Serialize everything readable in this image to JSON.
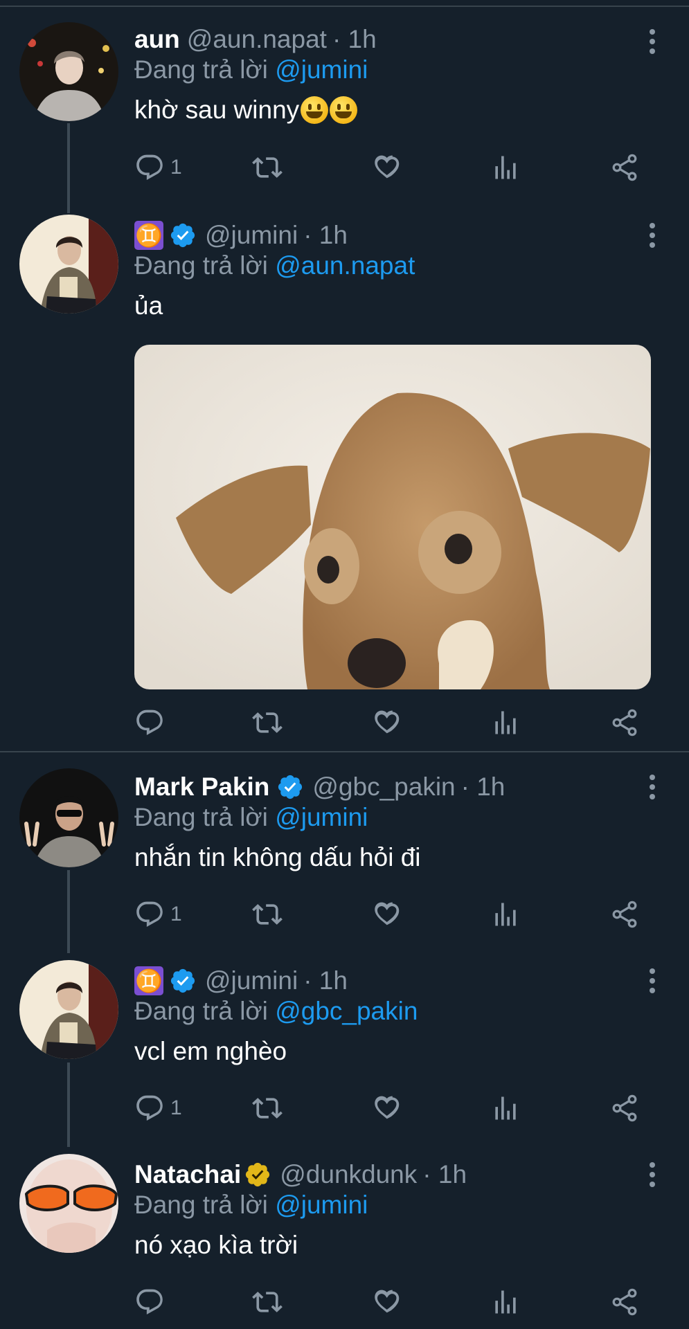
{
  "tweets": [
    {
      "name": "aun",
      "handle": "@aun.napat",
      "time": "· 1h",
      "reply_prefix": "Đang trả lời",
      "reply_to": "@jumini",
      "text": "khờ sau winny",
      "emojis": [
        "grinning-face",
        "grinning-face"
      ],
      "reply_count": "1",
      "verified": null
    },
    {
      "name": "♊",
      "handle": "@jumini",
      "time": "· 1h",
      "reply_prefix": "Đang trả lời",
      "reply_to": "@aun.napat",
      "text": "ủa",
      "reply_count": "",
      "verified": "blue",
      "media": "puppy-image"
    },
    {
      "name": "Mark Pakin",
      "handle": "@gbc_pakin",
      "time": "· 1h",
      "reply_prefix": "Đang trả lời",
      "reply_to": "@jumini",
      "text": "nhắn tin không dấu hỏi đi",
      "reply_count": "1",
      "verified": "blue"
    },
    {
      "name": "♊",
      "handle": "@jumini",
      "time": "· 1h",
      "reply_prefix": "Đang trả lời",
      "reply_to": "@gbc_pakin",
      "text": "vcl em nghèo",
      "reply_count": "1",
      "verified": "blue"
    },
    {
      "name": "Natachai",
      "handle": "@dunkdunk",
      "time": "· 1h",
      "reply_prefix": "Đang trả lời",
      "reply_to": "@jumini",
      "text": "nó xạo kìa trời",
      "reply_count": "",
      "verified": "gold"
    }
  ],
  "colors": {
    "background": "#15202b",
    "secondary_text": "#8b98a5",
    "link": "#1d9bf0",
    "verified_blue": "#1d9bf0",
    "verified_gold": "#e2b719",
    "divider": "#38444d"
  },
  "icons": [
    "reply-icon",
    "retweet-icon",
    "like-icon",
    "views-icon",
    "share-icon",
    "more-icon"
  ]
}
